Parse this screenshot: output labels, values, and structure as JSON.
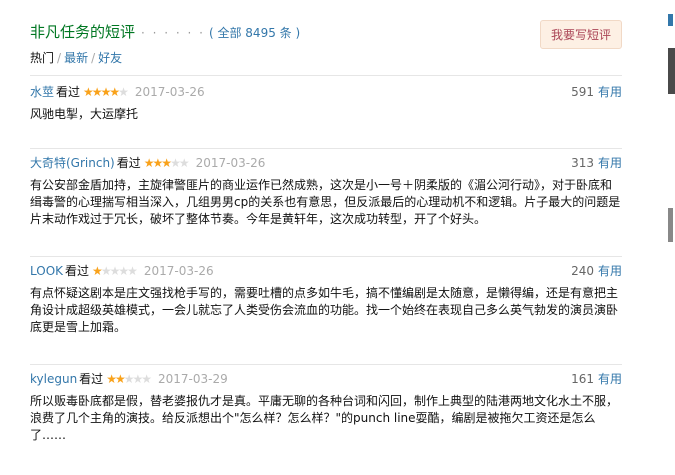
{
  "header": {
    "title": "非凡任务的短评",
    "dots": "· · · · · ·",
    "total": "( 全部 8495 条 )",
    "write_button": "我要写短评"
  },
  "tabs": {
    "hot": "热门",
    "separator": "/",
    "latest": "最新",
    "friends": "好友"
  },
  "comments": [
    {
      "author": "水莖",
      "seen": "看过",
      "stars": 4,
      "date": "2017-03-26",
      "votes": "591",
      "useful": "有用",
      "text": "风驰电掣，大运摩托"
    },
    {
      "author": "大奇特(Grinch)",
      "seen": "看过",
      "stars": 3,
      "date": "2017-03-26",
      "votes": "313",
      "useful": "有用",
      "text": "有公安部金盾加持，主旋律警匪片的商业运作已然成熟，这次是小一号＋阴柔版的《湄公河行动》，对于卧底和缉毒警的心理揣写相当深入，几组男男cp的关系也有意思，但反派最后的心理动机不和逻辑。片子最大的问题是片末动作戏过于冗长，破坏了整体节奏。今年是黄轩年，这次成功转型，开了个好头。"
    },
    {
      "author": "LOOK",
      "seen": "看过",
      "stars": 1,
      "date": "2017-03-26",
      "votes": "240",
      "useful": "有用",
      "text": "有点怀疑这剧本是庄文强找枪手写的，需要吐槽的点多如牛毛，搞不懂编剧是太随意，是懒得编，还是有意把主角设计成超级英雄模式，一会儿就忘了人类受伤会流血的功能。找一个始终在表现自己多么英气勃发的演员演卧底更是雪上加霜。"
    },
    {
      "author": "kylegun",
      "seen": "看过",
      "stars": 2,
      "date": "2017-03-29",
      "votes": "161",
      "useful": "有用",
      "text": "所以贩毒卧底都是假，替老婆报仇才是真。平庸无聊的各种台词和闪回，制作上典型的陆港两地文化水土不服，浪费了几个主角的演技。给反派想出个\"怎么样？怎么样？\"的punch line耍酷，编剧是被拖欠工资还是怎么了……"
    }
  ]
}
